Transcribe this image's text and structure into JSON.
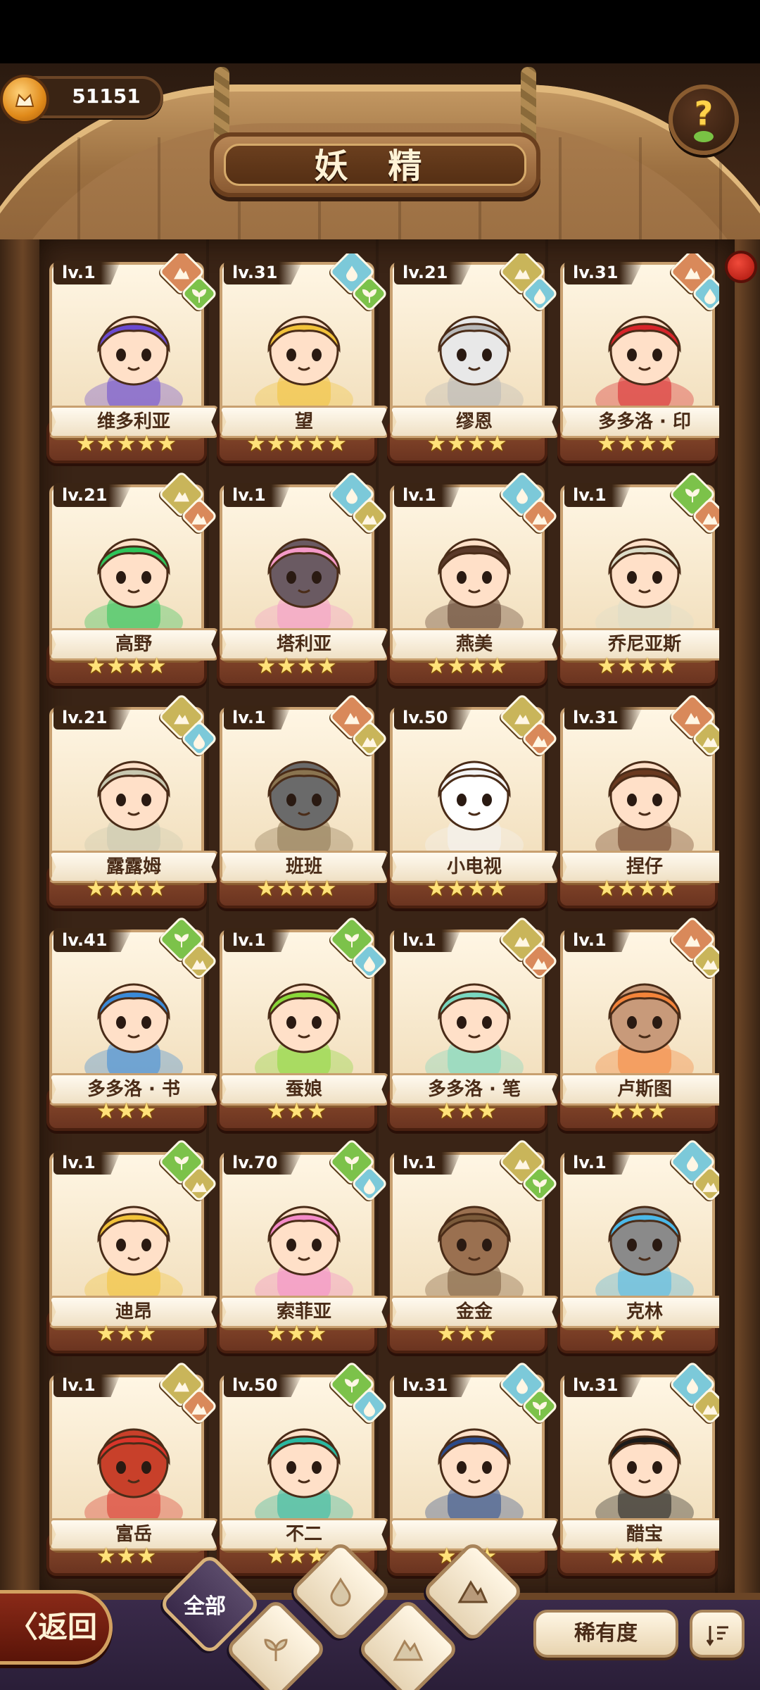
{
  "header": {
    "currency_value": "51151",
    "title": "妖 精",
    "help_glyph": "?"
  },
  "colors": {
    "fire_gem": "#d9895a",
    "water_gem": "#7cc9d9",
    "earth_gem": "#c9b55a",
    "plant_gem": "#7cc24a",
    "star": "#ffe27a"
  },
  "cards": [
    {
      "level": "lv.1",
      "name": "维多利亚",
      "stars": 5,
      "gems": [
        "fire",
        "plant"
      ],
      "hair": "#6a4ad0",
      "skin": "#ffe0c8"
    },
    {
      "level": "lv.31",
      "name": "望",
      "stars": 5,
      "gems": [
        "water",
        "plant"
      ],
      "hair": "#f2c23a",
      "skin": "#ffe0c8"
    },
    {
      "level": "lv.21",
      "name": "缪恩",
      "stars": 4,
      "gems": [
        "earth",
        "water"
      ],
      "hair": "#b8b8b8",
      "skin": "#e8e8e8"
    },
    {
      "level": "lv.31",
      "name": "多多洛 · 印",
      "stars": 4,
      "gems": [
        "fire",
        "water"
      ],
      "hair": "#d8242a",
      "skin": "#ffe0c8"
    },
    {
      "level": "lv.21",
      "name": "高野",
      "stars": 4,
      "gems": [
        "earth",
        "fire"
      ],
      "hair": "#2ec45a",
      "skin": "#ffe0c8"
    },
    {
      "level": "lv.1",
      "name": "塔利亚",
      "stars": 4,
      "gems": [
        "water",
        "earth"
      ],
      "hair": "#f49ac8",
      "skin": "#6a5a62"
    },
    {
      "level": "lv.1",
      "name": "燕美",
      "stars": 4,
      "gems": [
        "water",
        "fire"
      ],
      "hair": "#5a3a2a",
      "skin": "#ffe0c8"
    },
    {
      "level": "lv.1",
      "name": "乔尼亚斯",
      "stars": 4,
      "gems": [
        "plant",
        "fire"
      ],
      "hair": "#dcdcc8",
      "skin": "#ffe0c8"
    },
    {
      "level": "lv.21",
      "name": "露露姆",
      "stars": 4,
      "gems": [
        "earth",
        "water"
      ],
      "hair": "#c8c8b0",
      "skin": "#ffe0c8"
    },
    {
      "level": "lv.1",
      "name": "班班",
      "stars": 4,
      "gems": [
        "fire",
        "earth"
      ],
      "hair": "#8a7450",
      "skin": "#6a6a6a"
    },
    {
      "level": "lv.50",
      "name": "小电视",
      "stars": 4,
      "gems": [
        "earth",
        "fire"
      ],
      "hair": "#f4f4f4",
      "skin": "#ffffff"
    },
    {
      "level": "lv.31",
      "name": "捏仔",
      "stars": 4,
      "gems": [
        "fire",
        "earth"
      ],
      "hair": "#6a3a20",
      "skin": "#ffe0c8"
    },
    {
      "level": "lv.41",
      "name": "多多洛 · 书",
      "stars": 3,
      "gems": [
        "plant",
        "earth"
      ],
      "hair": "#3a8ad8",
      "skin": "#ffe0c8"
    },
    {
      "level": "lv.1",
      "name": "蚕娘",
      "stars": 3,
      "gems": [
        "plant",
        "water"
      ],
      "hair": "#8ad83a",
      "skin": "#ffe0c8"
    },
    {
      "level": "lv.1",
      "name": "多多洛 · 笔",
      "stars": 3,
      "gems": [
        "earth",
        "fire"
      ],
      "hair": "#7ad8c0",
      "skin": "#ffe0c8"
    },
    {
      "level": "lv.1",
      "name": "卢斯图",
      "stars": 3,
      "gems": [
        "fire",
        "earth"
      ],
      "hair": "#f4843a",
      "skin": "#c89a7a"
    },
    {
      "level": "lv.1",
      "name": "迪昂",
      "stars": 3,
      "gems": [
        "plant",
        "earth"
      ],
      "hair": "#f2c23a",
      "skin": "#ffe0c8"
    },
    {
      "level": "lv.70",
      "name": "索菲亚",
      "stars": 3,
      "gems": [
        "plant",
        "water"
      ],
      "hair": "#f48ac8",
      "skin": "#ffe0c8"
    },
    {
      "level": "lv.1",
      "name": "金金",
      "stars": 3,
      "gems": [
        "earth",
        "plant"
      ],
      "hair": "#7a5a3a",
      "skin": "#9a7050"
    },
    {
      "level": "lv.1",
      "name": "克林",
      "stars": 3,
      "gems": [
        "water",
        "earth"
      ],
      "hair": "#4ab8e8",
      "skin": "#8a8a8a"
    },
    {
      "level": "lv.1",
      "name": "富岳",
      "stars": 3,
      "gems": [
        "earth",
        "fire"
      ],
      "hair": "#d8342a",
      "skin": "#c8402a"
    },
    {
      "level": "lv.50",
      "name": "不二",
      "stars": 3,
      "gems": [
        "plant",
        "water"
      ],
      "hair": "#2ab8a0",
      "skin": "#ffe0c8"
    },
    {
      "level": "lv.31",
      "name": "",
      "stars": 3,
      "gems": [
        "water",
        "plant"
      ],
      "hair": "#2a4a8a",
      "skin": "#ffe0c8"
    },
    {
      "level": "lv.31",
      "name": "醋宝",
      "stars": 3,
      "gems": [
        "water",
        "earth"
      ],
      "hair": "#1a1a1a",
      "skin": "#ffe0c8"
    }
  ],
  "bottom": {
    "back_label": "〈返回",
    "all_label": "全部",
    "rarity_label": "稀有度"
  }
}
